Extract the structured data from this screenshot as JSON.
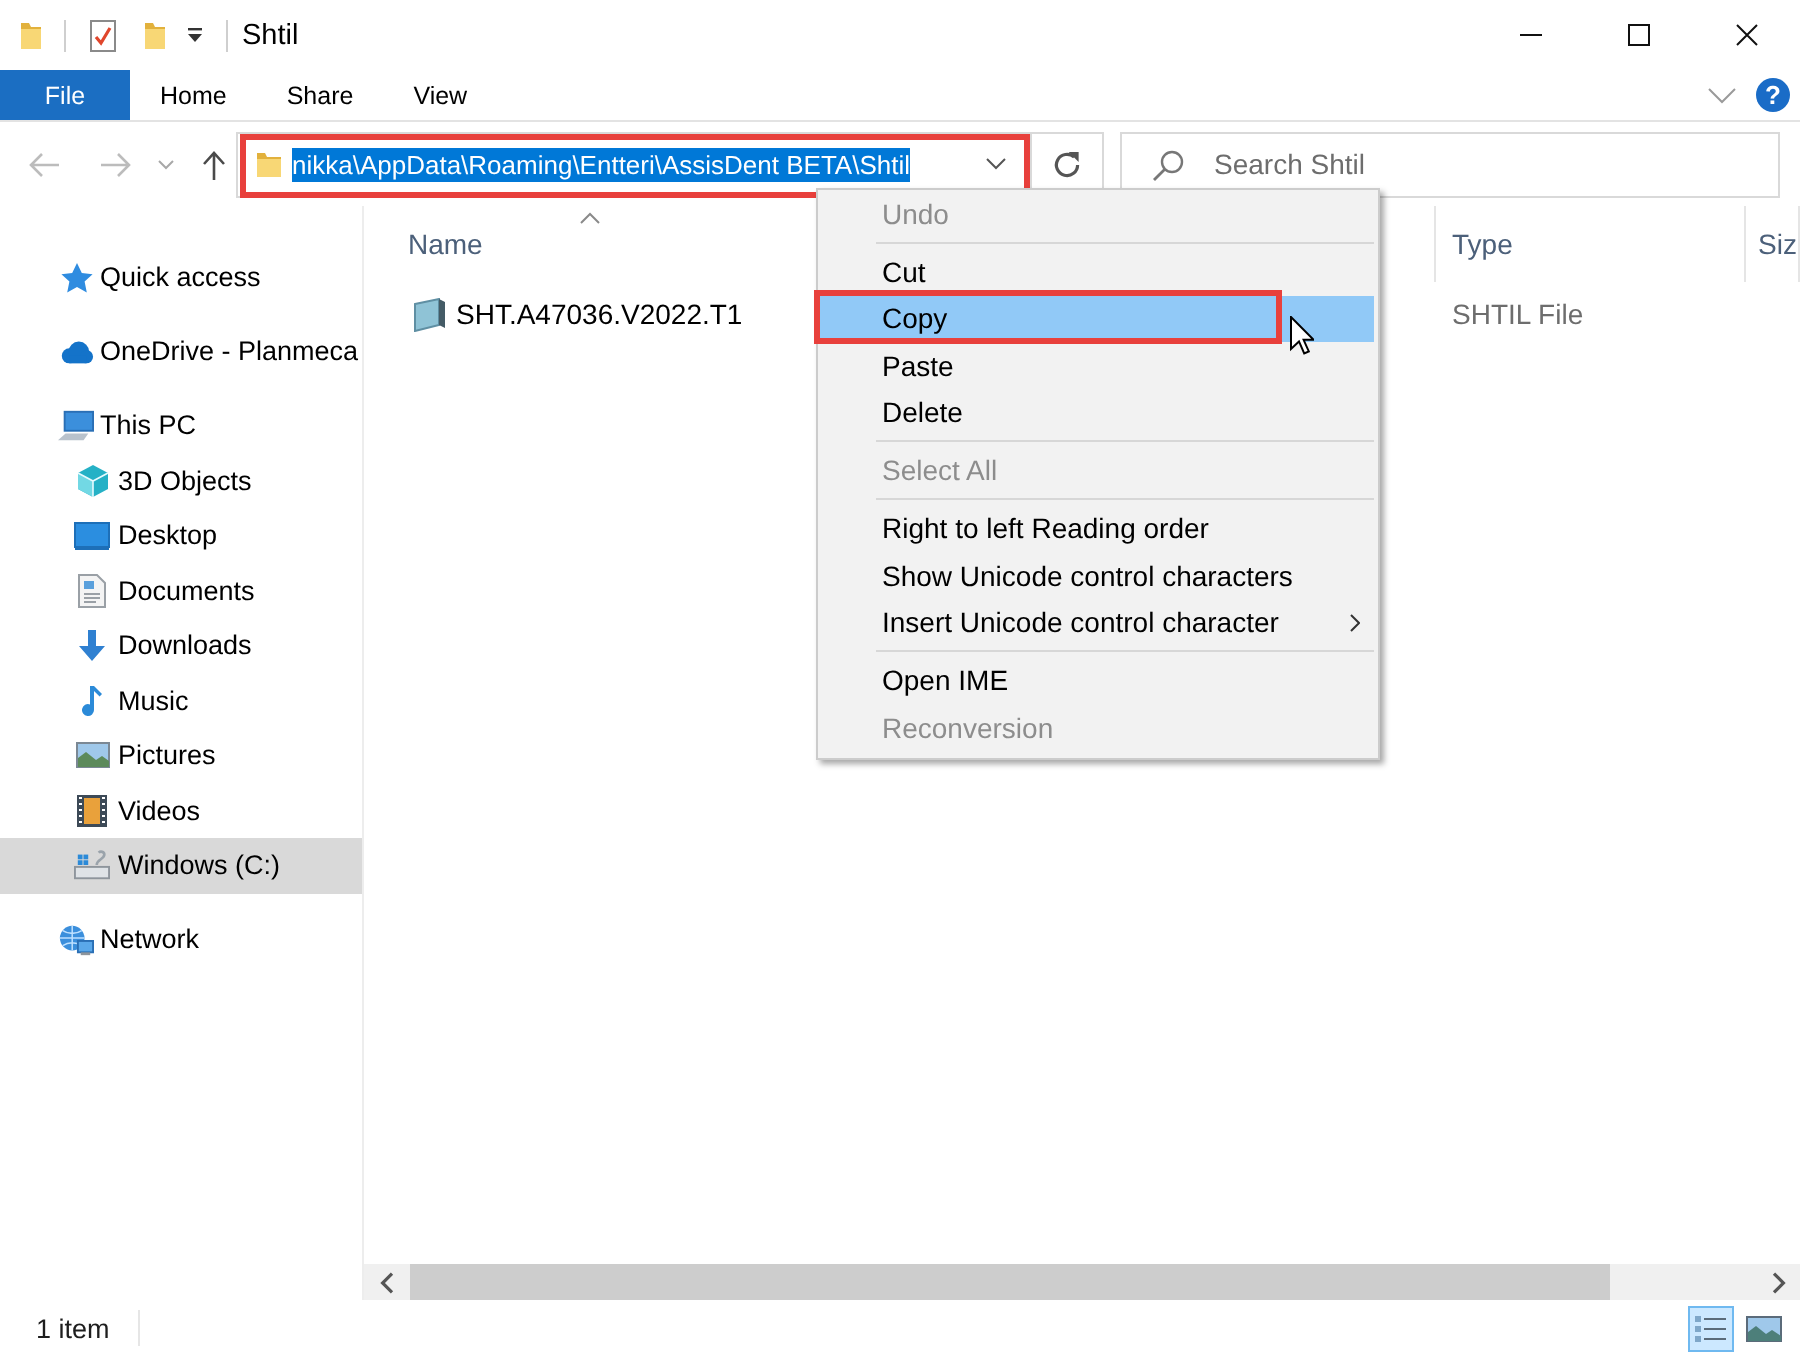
{
  "window": {
    "title": "Shtil"
  },
  "ribbon": {
    "tabs": [
      {
        "label": "File",
        "kind": "backstage",
        "selected": false
      },
      {
        "label": "Home",
        "kind": "tab",
        "selected": false
      },
      {
        "label": "Share",
        "kind": "tab",
        "selected": false
      },
      {
        "label": "View",
        "kind": "tab",
        "selected": false
      }
    ],
    "help_label": "?"
  },
  "address_bar": {
    "value": "nikka\\AppData\\Roaming\\Entteri\\AssisDent BETA\\Shtil",
    "text_selected": true,
    "marked": true
  },
  "search": {
    "placeholder": "Search Shtil"
  },
  "navigation": {
    "items": [
      {
        "label": "Quick access",
        "selected": false
      },
      {
        "label": "OneDrive - Planmeca",
        "selected": false
      },
      {
        "label": "This PC",
        "selected": false,
        "children": [
          {
            "label": "3D Objects",
            "selected": false
          },
          {
            "label": "Desktop",
            "selected": false
          },
          {
            "label": "Documents",
            "selected": false
          },
          {
            "label": "Downloads",
            "selected": false
          },
          {
            "label": "Music",
            "selected": false
          },
          {
            "label": "Pictures",
            "selected": false
          },
          {
            "label": "Videos",
            "selected": false
          },
          {
            "label": "Windows (C:)",
            "selected": true
          }
        ]
      },
      {
        "label": "Network",
        "selected": false
      }
    ]
  },
  "file_list": {
    "columns": [
      {
        "label": "Name",
        "sorted": true
      },
      {
        "label": "Type",
        "sorted": false
      },
      {
        "label": "Siz",
        "sorted": false
      }
    ],
    "rows": [
      {
        "name": "SHT.A47036.V2022.T1",
        "type": "SHTIL File"
      }
    ]
  },
  "context_menu": {
    "groups": [
      {
        "items": [
          {
            "label": "Undo",
            "disabled": true,
            "highlighted": false,
            "marked": false,
            "submenu": false
          }
        ]
      },
      {
        "items": [
          {
            "label": "Cut",
            "disabled": false,
            "highlighted": false,
            "marked": false,
            "submenu": false
          },
          {
            "label": "Copy",
            "disabled": false,
            "highlighted": true,
            "marked": true,
            "submenu": false
          },
          {
            "label": "Paste",
            "disabled": false,
            "highlighted": false,
            "marked": false,
            "submenu": false
          },
          {
            "label": "Delete",
            "disabled": false,
            "highlighted": false,
            "marked": false,
            "submenu": false
          }
        ]
      },
      {
        "items": [
          {
            "label": "Select All",
            "disabled": true,
            "highlighted": false,
            "marked": false,
            "submenu": false
          }
        ]
      },
      {
        "items": [
          {
            "label": "Right to left Reading order",
            "disabled": false,
            "highlighted": false,
            "marked": false,
            "submenu": false
          },
          {
            "label": "Show Unicode control characters",
            "disabled": false,
            "highlighted": false,
            "marked": false,
            "submenu": false
          },
          {
            "label": "Insert Unicode control character",
            "disabled": false,
            "highlighted": false,
            "marked": false,
            "submenu": true
          }
        ]
      },
      {
        "items": [
          {
            "label": "Open IME",
            "disabled": false,
            "highlighted": false,
            "marked": false,
            "submenu": false
          },
          {
            "label": "Reconversion",
            "disabled": true,
            "highlighted": false,
            "marked": false,
            "submenu": false
          }
        ]
      }
    ]
  },
  "status_bar": {
    "item_count": "1 item",
    "view_buttons": [
      {
        "selected": true
      },
      {
        "selected": false
      }
    ]
  }
}
